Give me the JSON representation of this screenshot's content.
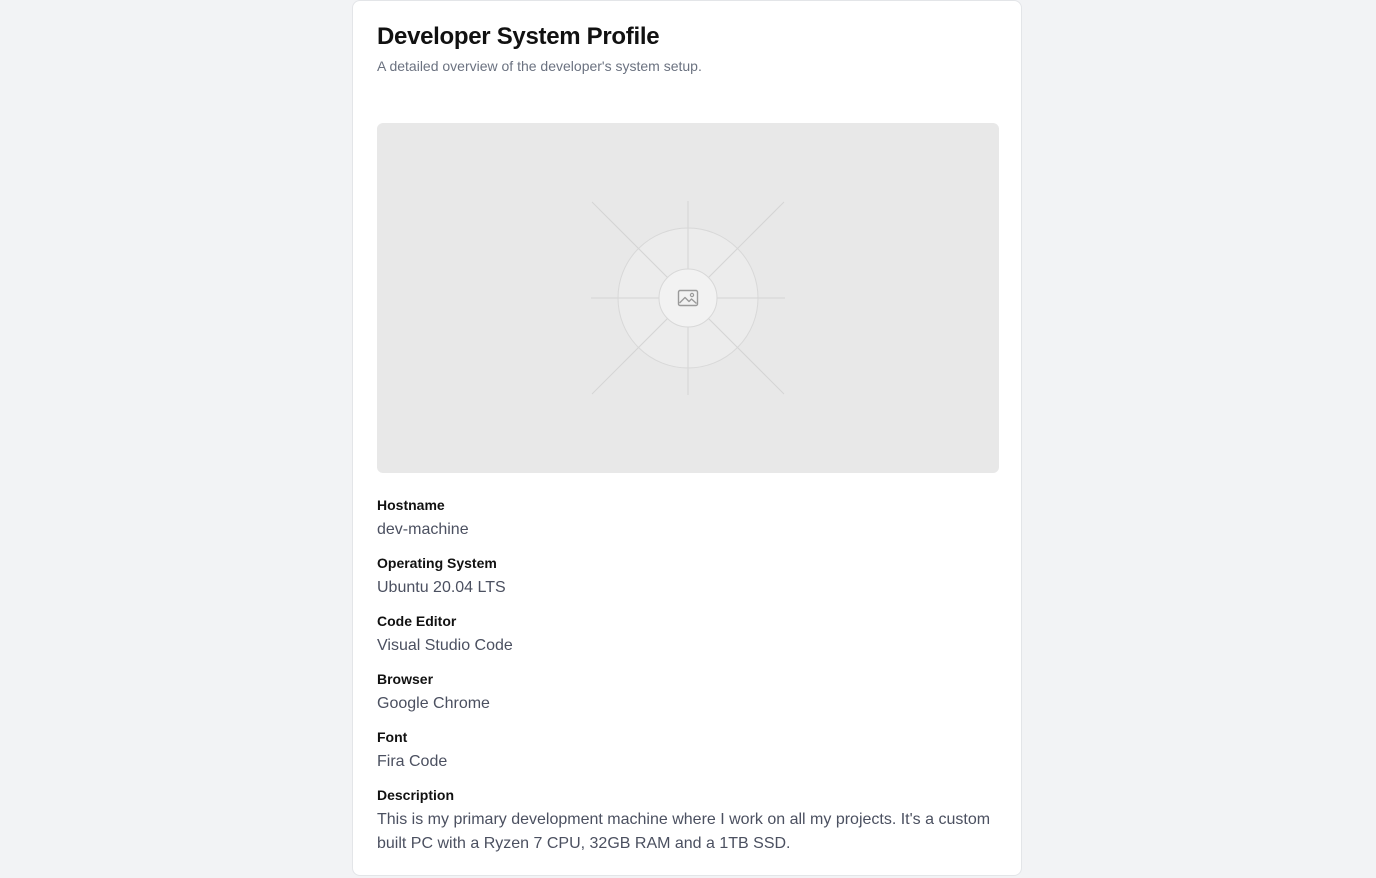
{
  "profile": {
    "title": "Developer System Profile",
    "subtitle": "A detailed overview of the developer's system setup.",
    "image_icon": "image-icon"
  },
  "fields": [
    {
      "label": "Hostname",
      "value": "dev-machine"
    },
    {
      "label": "Operating System",
      "value": "Ubuntu 20.04 LTS"
    },
    {
      "label": "Code Editor",
      "value": "Visual Studio Code"
    },
    {
      "label": "Browser",
      "value": "Google Chrome"
    },
    {
      "label": "Font",
      "value": "Fira Code"
    },
    {
      "label": "Description",
      "value": "This is my primary development machine where I work on all my projects. It's a custom built PC with a Ryzen 7 CPU, 32GB RAM and a 1TB SSD."
    }
  ],
  "colors": {
    "page_background": "#f2f3f5",
    "card_background": "#ffffff",
    "placeholder_background": "#e8e8e8",
    "text_primary": "#111111",
    "text_secondary": "#6b7280",
    "text_value": "#4b5060"
  }
}
